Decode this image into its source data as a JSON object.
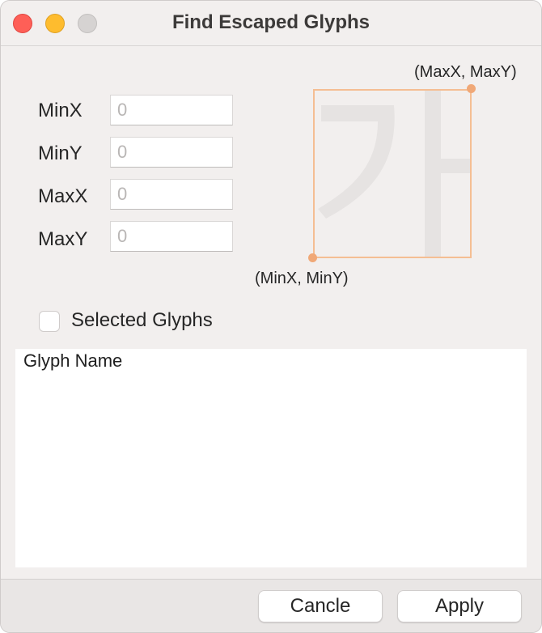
{
  "window": {
    "title": "Find Escaped Glyphs"
  },
  "fields": [
    {
      "label": "MinX",
      "placeholder": "0",
      "value": ""
    },
    {
      "label": "MinY",
      "placeholder": "0",
      "value": ""
    },
    {
      "label": "MaxX",
      "placeholder": "0",
      "value": ""
    },
    {
      "label": "MaxY",
      "placeholder": "0",
      "value": ""
    }
  ],
  "preview": {
    "max_label": "(MaxX, MaxY)",
    "min_label": "(MinX, MinY)",
    "glyph": "가",
    "frame_color": "#f5be93",
    "dot_color": "#f0a877",
    "glyph_color": "#e6e3e2"
  },
  "selected_glyphs": {
    "label": "Selected Glyphs",
    "checked": false
  },
  "glyph_list": {
    "header": "Glyph Name",
    "rows": []
  },
  "footer": {
    "cancel_label": "Cancle",
    "apply_label": "Apply"
  }
}
